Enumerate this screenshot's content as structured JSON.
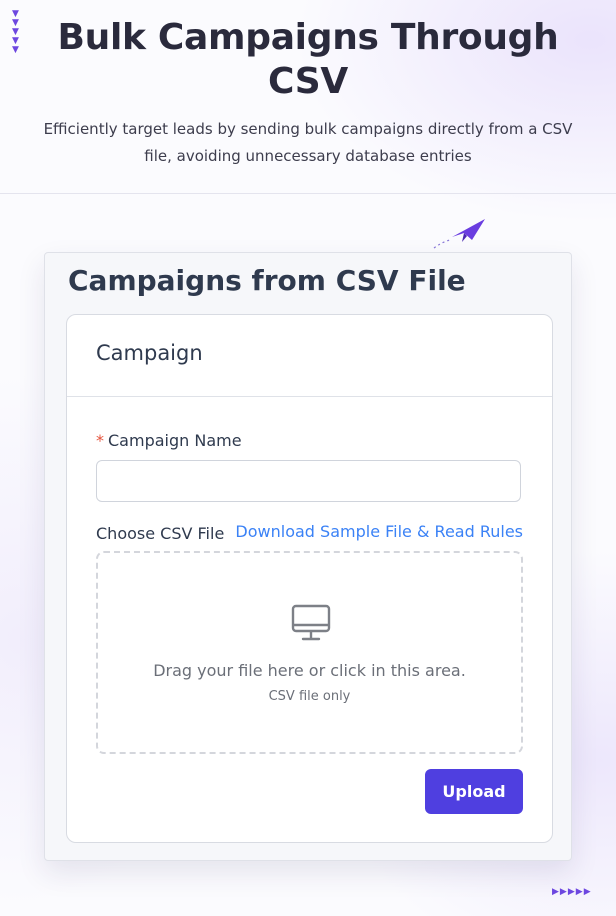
{
  "header": {
    "title": "Bulk Campaigns Through CSV",
    "subtitle": "Efficiently target leads by sending bulk campaigns directly from a CSV file, avoiding unnecessary database entries"
  },
  "card": {
    "title": "Campaigns from CSV File",
    "section_title": "Campaign",
    "form": {
      "required_marker": "*",
      "campaign_name_label": "Campaign Name",
      "campaign_name_value": "",
      "choose_file_label": "Choose CSV File",
      "sample_link": "Download Sample File & Read Rules",
      "dropzone_text": "Drag your file here or click in this area.",
      "dropzone_hint": "CSV file only",
      "upload_label": "Upload"
    }
  },
  "icons": {
    "decor_arrows": "triangle-down-icon",
    "paper_plane": "paper-plane-icon",
    "dropzone": "monitor-icon"
  },
  "colors": {
    "accent": "#4f3fe0",
    "link": "#3b82f6",
    "required": "#e5533c"
  }
}
